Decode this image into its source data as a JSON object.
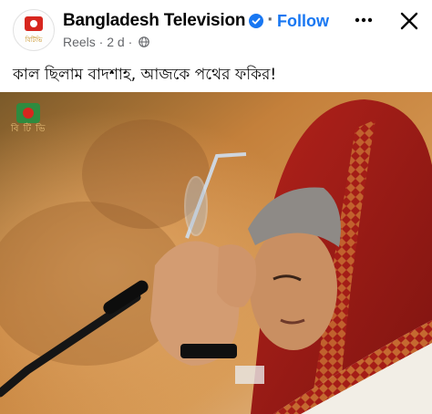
{
  "header": {
    "avatar_text": "বিটিভি",
    "page_name": "Bangladesh Television",
    "follow_label": "Follow",
    "meta_label": "Reels · 2 d ·",
    "verified_icon": "verified-badge-icon",
    "more_icon": "more-horizontal-icon",
    "close_icon": "close-icon",
    "globe_icon": "globe-icon"
  },
  "post": {
    "caption": "কাল ছিলাম বাদশাহ, আজকে পথের ফকির!",
    "watermark_text": "বি টি ভি"
  },
  "colors": {
    "brand_blue": "#1877f2",
    "secondary_text": "#65676b",
    "logo_red": "#d7261e"
  }
}
